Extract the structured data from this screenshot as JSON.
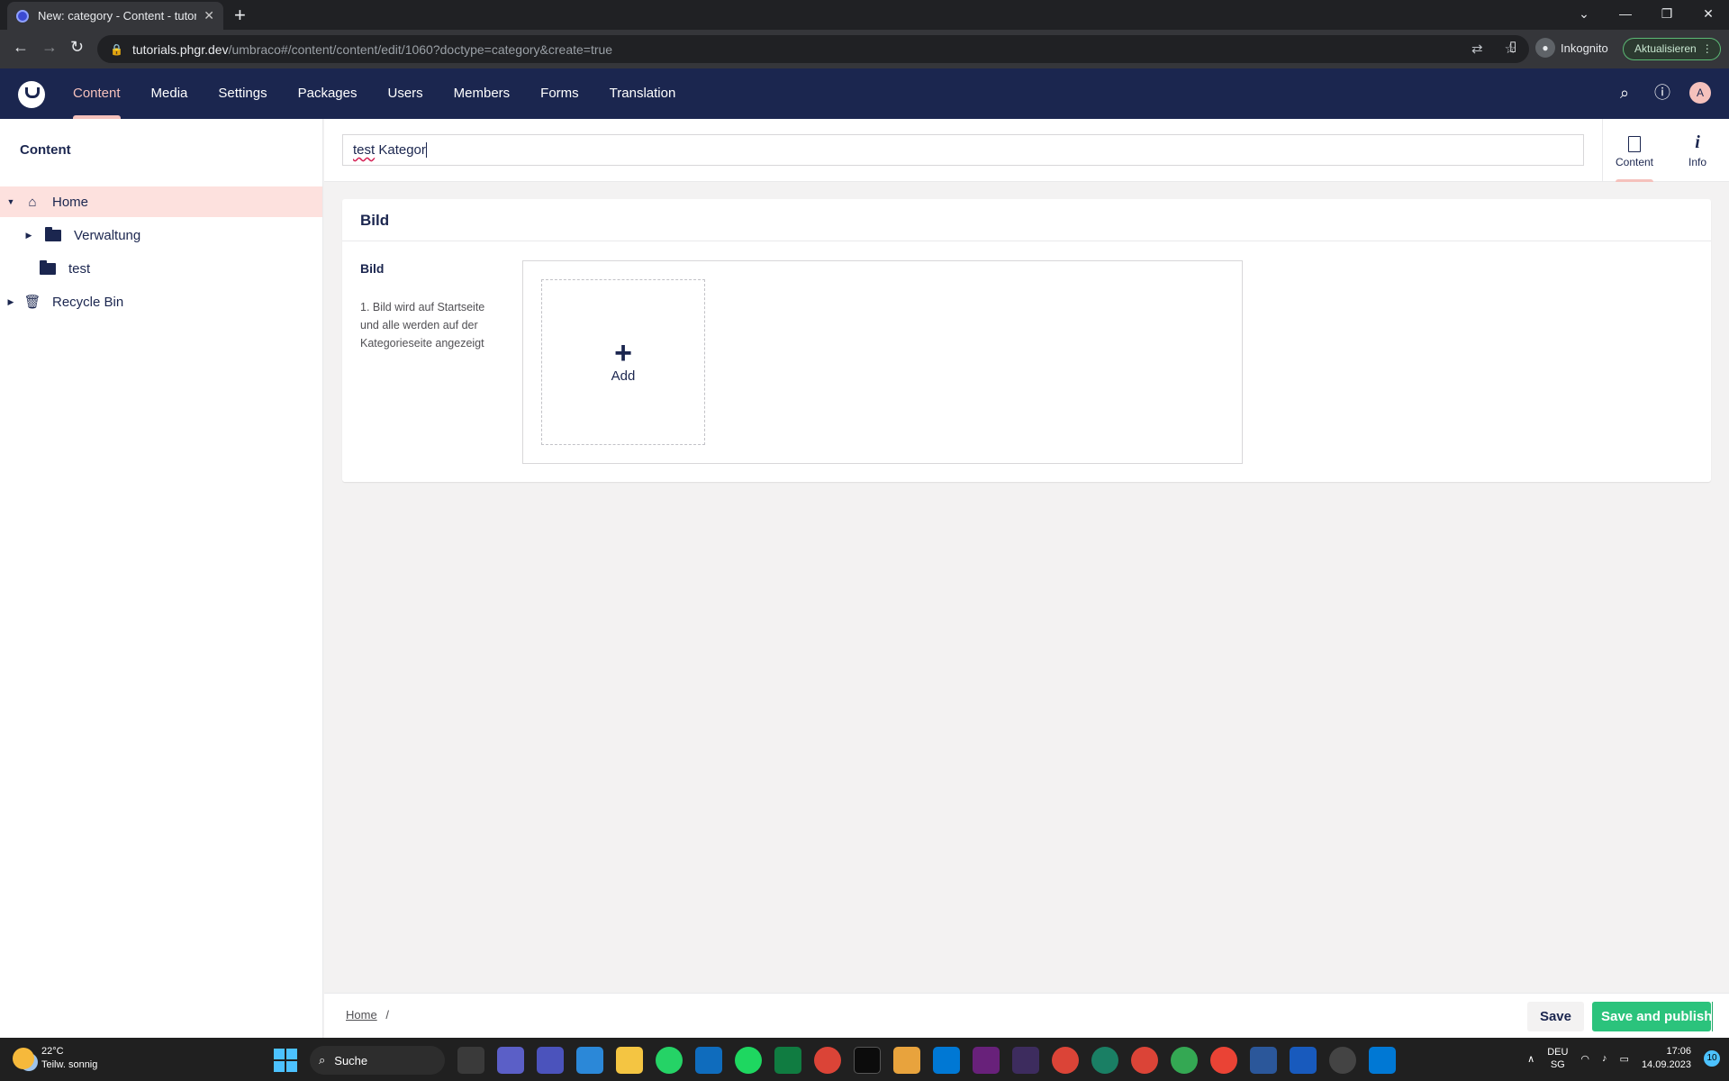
{
  "browser": {
    "tab_title": "New: category - Content - tutoria",
    "url_host": "tutorials.phgr.dev",
    "url_path": "/umbraco#/content/content/edit/1060?doctype=category&create=true",
    "incognito_label": "Inkognito",
    "update_label": "Aktualisieren"
  },
  "header": {
    "nav": [
      "Content",
      "Media",
      "Settings",
      "Packages",
      "Users",
      "Members",
      "Forms",
      "Translation"
    ],
    "active": "Content",
    "avatar_initial": "A"
  },
  "tree": {
    "title": "Content",
    "items": [
      {
        "label": "Home",
        "icon": "home-icon",
        "selected": true
      },
      {
        "label": "Verwaltung",
        "icon": "folder-icon"
      },
      {
        "label": "test",
        "icon": "folder-icon"
      },
      {
        "label": "Recycle Bin",
        "icon": "trash-icon"
      }
    ]
  },
  "editor": {
    "name_value_spell": "test",
    "name_value_rest": " Kategor",
    "apps": [
      {
        "label": "Content",
        "icon": "document-icon"
      },
      {
        "label": "Info",
        "icon": "info-icon"
      }
    ],
    "group_title": "Bild",
    "property_label": "Bild",
    "property_description": "1. Bild wird auf Startseite und alle werden auf der Kategorieseite angezeigt",
    "add_label": "Add"
  },
  "footer": {
    "breadcrumb_home": "Home",
    "breadcrumb_sep": "/",
    "save_label": "Save",
    "publish_label": "Save and publish"
  },
  "taskbar": {
    "temperature": "22°C",
    "weather_text": "Teilw. sonnig",
    "search_label": "Suche",
    "lang_top": "DEU",
    "lang_bottom": "SG",
    "time": "17:06",
    "date": "14.09.2023",
    "notification_count": "10"
  },
  "colors": {
    "brand": "#1b264f",
    "accent": "#f5c1bc",
    "publish": "#2bc37c"
  }
}
